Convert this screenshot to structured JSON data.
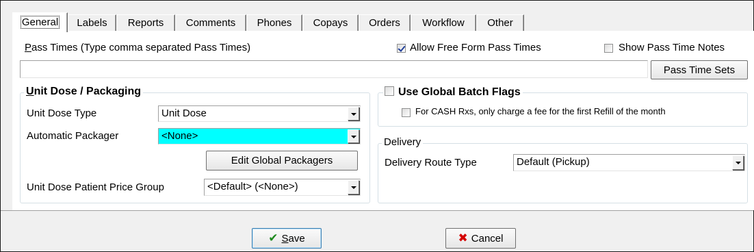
{
  "tabs": [
    {
      "label": "General",
      "active": true
    },
    {
      "label": "Labels"
    },
    {
      "label": "Reports"
    },
    {
      "label": "Comments"
    },
    {
      "label": "Phones"
    },
    {
      "label": "Copays"
    },
    {
      "label": "Orders"
    },
    {
      "label": "Workflow"
    },
    {
      "label": "Other"
    }
  ],
  "pass_times": {
    "label_first": "P",
    "label_rest": "ass Times (Type comma separated Pass Times)",
    "value": "",
    "allow_free_form_label": "Allow Free Form Pass Times",
    "allow_free_form_checked": true,
    "show_notes_label": "Show Pass Time Notes",
    "show_notes_checked": false,
    "sets_button": "Pass Time Sets"
  },
  "unit_dose": {
    "title_first": "U",
    "title_rest": "nit Dose / Packaging",
    "type_label": "Unit Dose Type",
    "type_value": "Unit Dose",
    "packager_label": "Automatic Packager",
    "packager_value": "<None>",
    "edit_button": "Edit Global Packagers",
    "price_group_label": "Unit Dose Patient Price Group",
    "price_group_value": "<Default> (<None>)"
  },
  "batch_flags": {
    "title": "Use Global Batch Flags",
    "checked": false,
    "cash_label": "For CASH Rxs, only charge a fee for the first Refill of the month",
    "cash_checked": false
  },
  "delivery": {
    "title": "Delivery",
    "route_label": "Delivery Route Type",
    "route_value": "Default (Pickup)"
  },
  "footer": {
    "save_first": "S",
    "save_rest": "ave",
    "cancel": "Cancel"
  },
  "colors": {
    "highlight": "#00ffff",
    "save_icon": "#1f8a1f",
    "cancel_icon": "#d40000"
  }
}
